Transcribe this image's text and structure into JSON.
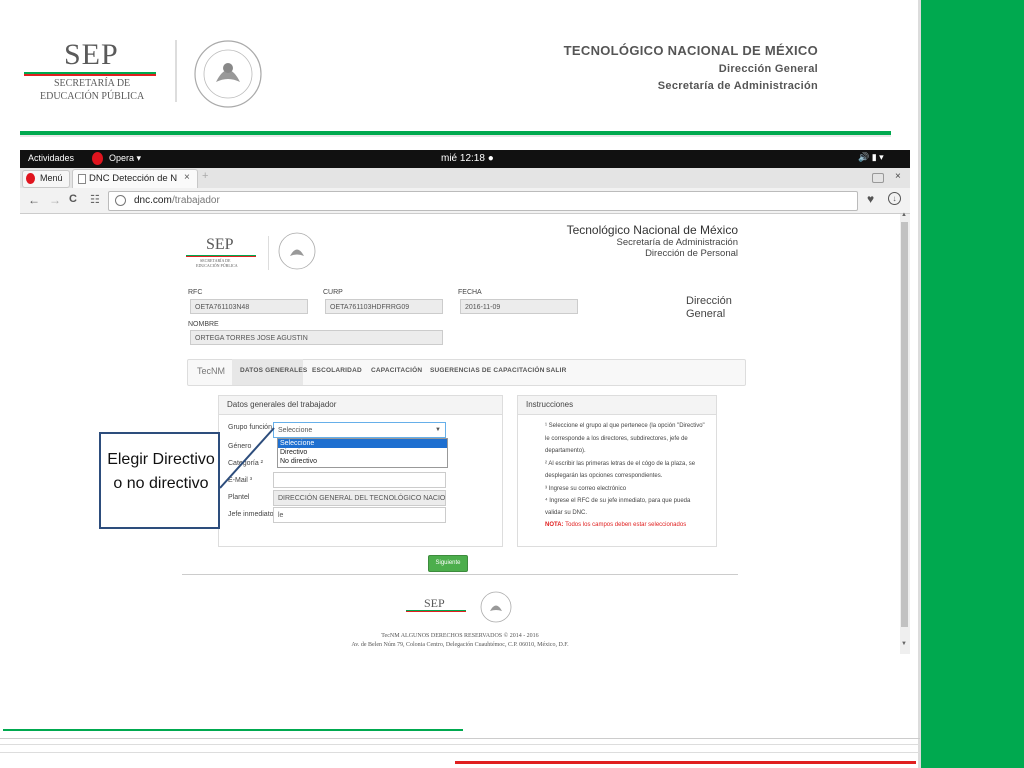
{
  "slide": {
    "sep_logo": "SEP",
    "sep_sub1": "SECRETARÍA DE",
    "sep_sub2": "EDUCACIÓN PÚBLICA",
    "title": "TECNOLÓGICO NACIONAL DE MÉXICO",
    "subtitle1": "Dirección General",
    "subtitle2": "Secretaría de Administración",
    "callout": "Elegir Directivo o no directivo",
    "colors": {
      "green": "#00a94f",
      "red": "#e02020"
    }
  },
  "gnome": {
    "activities": "Actividades",
    "app": "Opera ▾",
    "clock": "mié 12:18 ●",
    "tray": "🔊  ▮  ▾"
  },
  "browser": {
    "menu": "Menú",
    "tab_title": "DNC Detección de N",
    "tab_close": "×",
    "new_tab": "+",
    "url_host": "dnc.com",
    "url_path": "/trabajador",
    "close_x": "×"
  },
  "page": {
    "logo": "SEP",
    "logo_sub1": "SECRETARÍA DE",
    "logo_sub2": "EDUCACIÓN PÚBLICA",
    "org_title": "Tecnológico Nacional de México",
    "org_sub1": "Secretaría de Administración",
    "org_sub2": "Dirección de Personal",
    "dir_gen1": "Dirección",
    "dir_gen2": "General",
    "rfc_label": "RFC",
    "rfc_value": "OETA761103N48",
    "curp_label": "CURP",
    "curp_value": "OETA761103HDFRRG09",
    "fecha_label": "FECHA",
    "fecha_value": "2016-11-09",
    "nombre_label": "NOMBRE",
    "nombre_value": "ORTEGA TORRES JOSE AGUSTIN",
    "nav": {
      "brand": "TecNM",
      "items": [
        "DATOS GENERALES",
        "ESCOLARIDAD",
        "CAPACITACIÓN",
        "SUGERENCIAS DE CAPACITACIÓN",
        "SALIR"
      ]
    },
    "form": {
      "title": "Datos generales del trabajador",
      "grupo_label": "Grupo función ¹",
      "grupo_value": "Seleccione",
      "options": [
        "Seleccione",
        "Directivo",
        "No directivo"
      ],
      "genero_label": "Género",
      "categoria_label": "Categoría ²",
      "email_label": "E-Mail ³",
      "plantel_label": "Plantel",
      "plantel_value": "DIRECCIÓN GENERAL DEL TECNOLÓGICO NACIONAL",
      "jefe_label": "Jefe inmediato ⁴",
      "jefe_value": "le"
    },
    "instructions": {
      "title": "Instrucciones",
      "l1": "¹ Seleccione el grupo al que pertenece (la opción \"Directivo\"",
      "l2": "le corresponde a los directores, subdirectores, jefe de",
      "l3": "departamento).",
      "l4": "² Al escribir las primeras letras de el cógo de la plaza, se",
      "l5": "desplegarán las opciones correspondientes.",
      "l6": "³ Ingrese su correo electrónico",
      "l7": "⁴ Ingrese el RFC de su jefe inmediato, para que pueda",
      "l8": "validar su DNC.",
      "nota_label": "NOTA:",
      "nota_text": " Todos los campos deben estar seleccionados"
    },
    "next_button": "Siguiente",
    "footer_logo": "SEP",
    "footer1": "TecNM ALGUNOS DERECHOS RESERVADOS © 2014 - 2016",
    "footer2": "Av. de Belen Núm 79, Colonia Centro, Delegación Cuauhtémoc, C.P. 06010, México, D.F."
  }
}
